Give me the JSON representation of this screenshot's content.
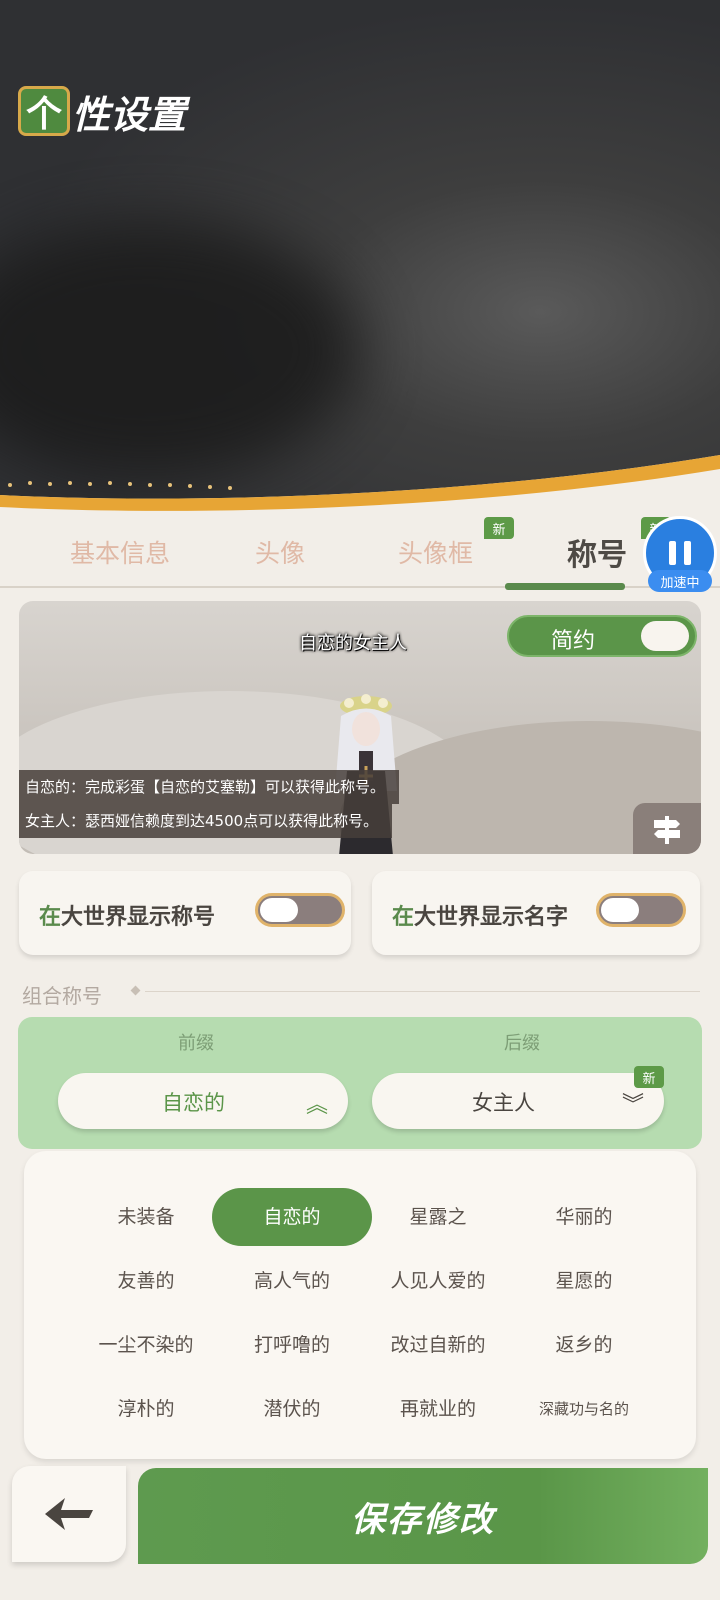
{
  "header": {
    "title_first_char": "个",
    "title_rest": "性设置"
  },
  "tabs": [
    {
      "label": "基本信息",
      "active": false
    },
    {
      "label": "头像",
      "active": false
    },
    {
      "label": "头像框",
      "active": false,
      "badge": "新"
    },
    {
      "label": "称号",
      "active": true,
      "badge": "新"
    }
  ],
  "overlay": {
    "speed_label": "加速中"
  },
  "preview": {
    "title": "自恋的女主人",
    "style_toggle_label": "简约",
    "desc1": "自恋的：完成彩蛋【自恋的艾塞勒】可以获得此称号。",
    "desc2": "女主人：瑟西娅信赖度到达4500点可以获得此称号。"
  },
  "options": {
    "show_title": {
      "prefix": "在",
      "text": "大世界显示称号",
      "on": false
    },
    "show_name": {
      "prefix": "在",
      "text": "大世界显示名字",
      "on": false
    }
  },
  "combo": {
    "section_label": "组合称号",
    "prefix_header": "前缀",
    "suffix_header": "后缀",
    "prefix_value": "自恋的",
    "suffix_value": "女主人",
    "suffix_badge": "新"
  },
  "prefix_list": [
    [
      "未装备",
      "自恋的",
      "星露之",
      "华丽的"
    ],
    [
      "友善的",
      "高人气的",
      "人见人爱的",
      "星愿的"
    ],
    [
      "一尘不染的",
      "打呼噜的",
      "改过自新的",
      "返乡的"
    ],
    [
      "淳朴的",
      "潜伏的",
      "再就业的",
      "深藏功与名的"
    ]
  ],
  "selected_prefix": "自恋的",
  "footer": {
    "save_label": "保存修改"
  },
  "colors": {
    "accent": "#5b9549",
    "panel": "#faf7f2",
    "combo_bg": "#b6dcb0"
  }
}
